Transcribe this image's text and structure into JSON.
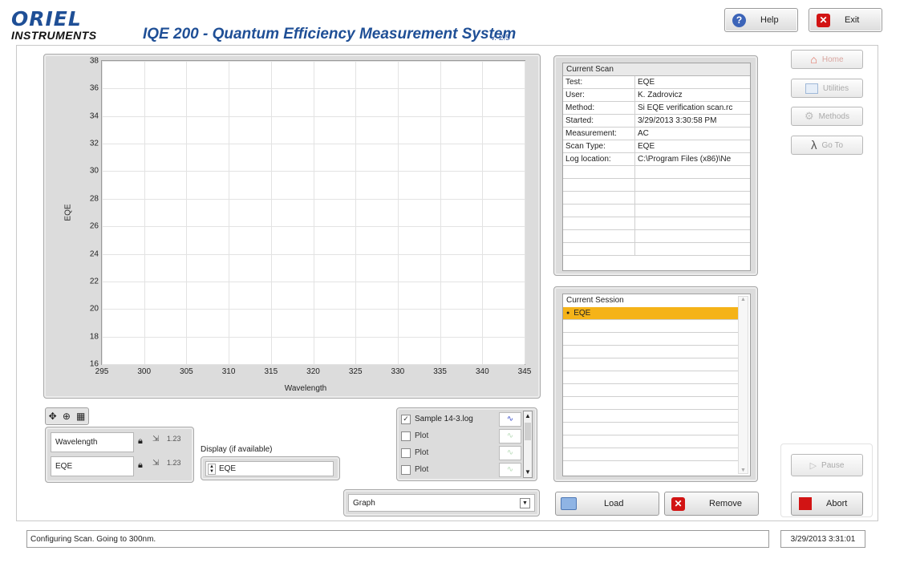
{
  "header": {
    "logo_top": "ORIEL",
    "logo_bottom": "INSTRUMENTS",
    "title": "IQE 200 - Quantum Efficiency Measurement System",
    "version": "v. 2.5",
    "help_label": "Help",
    "exit_label": "Exit"
  },
  "chart_data": {
    "type": "line",
    "xlabel": "Wavelength",
    "ylabel": "EQE",
    "xlim": [
      295,
      345
    ],
    "ylim": [
      16,
      38
    ],
    "x_ticks": [
      295,
      300,
      305,
      310,
      315,
      320,
      325,
      330,
      335,
      340,
      345
    ],
    "y_ticks": [
      16,
      18,
      20,
      22,
      24,
      26,
      28,
      30,
      32,
      34,
      36,
      38
    ],
    "grid": true,
    "series": []
  },
  "graph_controls": {
    "x_axis_label": "Wavelength",
    "x_axis_format": "1.23",
    "y_axis_label": "EQE",
    "y_axis_format": "1.23",
    "display_label": "Display (if available)",
    "display_value": "EQE"
  },
  "plots": [
    {
      "label": "Sample 14-3.log",
      "checked": true
    },
    {
      "label": "Plot",
      "checked": false
    },
    {
      "label": "Plot",
      "checked": false
    },
    {
      "label": "Plot",
      "checked": false
    }
  ],
  "view_select": {
    "value": "Graph"
  },
  "current_scan": {
    "title": "Current Scan",
    "rows": [
      {
        "key": "Test:",
        "value": "EQE"
      },
      {
        "key": "User:",
        "value": "K. Zadrovicz"
      },
      {
        "key": "Method:",
        "value": "Si EQE verification scan.rc"
      },
      {
        "key": "Started:",
        "value": "3/29/2013 3:30:58 PM"
      },
      {
        "key": "Measurement:",
        "value": "AC"
      },
      {
        "key": "Scan Type:",
        "value": "EQE"
      },
      {
        "key": "Log location:",
        "value": "C:\\Program Files (x86)\\Ne"
      },
      {
        "key": "",
        "value": ""
      },
      {
        "key": "",
        "value": ""
      },
      {
        "key": "",
        "value": ""
      },
      {
        "key": "",
        "value": ""
      },
      {
        "key": "",
        "value": ""
      },
      {
        "key": "",
        "value": ""
      },
      {
        "key": "",
        "value": ""
      }
    ]
  },
  "current_session": {
    "title": "Current Session",
    "items": [
      "EQE",
      "",
      "",
      "",
      "",
      "",
      "",
      "",
      "",
      "",
      "",
      ""
    ],
    "selected_index": 0
  },
  "buttons": {
    "load": "Load",
    "remove": "Remove",
    "pause": "Pause",
    "abort": "Abort"
  },
  "side_nav": [
    {
      "label": "Home",
      "icon": "home-icon"
    },
    {
      "label": "Utilities",
      "icon": "utilities-icon"
    },
    {
      "label": "Methods",
      "icon": "methods-icon"
    },
    {
      "label": "Go To",
      "icon": "lambda-icon"
    }
  ],
  "status": {
    "message": "Configuring Scan. Going to  300nm.",
    "timestamp": "3/29/2013 3:31:01"
  },
  "colors": {
    "brand": "#1f4f96",
    "selection": "#f5b318",
    "abort": "#d21414"
  }
}
